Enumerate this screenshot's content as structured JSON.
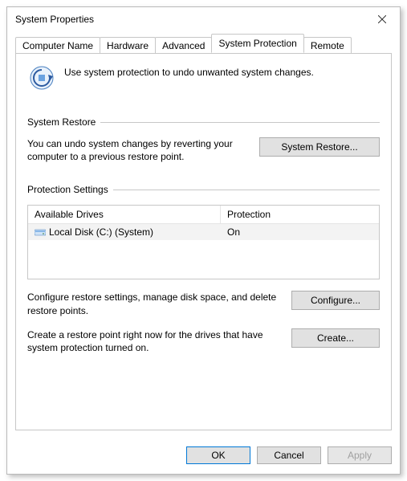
{
  "window": {
    "title": "System Properties"
  },
  "tabs": [
    {
      "label": "Computer Name"
    },
    {
      "label": "Hardware"
    },
    {
      "label": "Advanced"
    },
    {
      "label": "System Protection",
      "active": true
    },
    {
      "label": "Remote"
    }
  ],
  "intro": "Use system protection to undo unwanted system changes.",
  "restore": {
    "heading": "System Restore",
    "desc": "You can undo system changes by reverting your computer to a previous restore point.",
    "button": "System Restore..."
  },
  "protection": {
    "heading": "Protection Settings",
    "columns": {
      "drives": "Available Drives",
      "protection": "Protection"
    },
    "rows": [
      {
        "name": "Local Disk (C:) (System)",
        "status": "On"
      }
    ],
    "configure_desc": "Configure restore settings, manage disk space, and delete restore points.",
    "configure_btn": "Configure...",
    "create_desc": "Create a restore point right now for the drives that have system protection turned on.",
    "create_btn": "Create..."
  },
  "footer": {
    "ok": "OK",
    "cancel": "Cancel",
    "apply": "Apply"
  }
}
